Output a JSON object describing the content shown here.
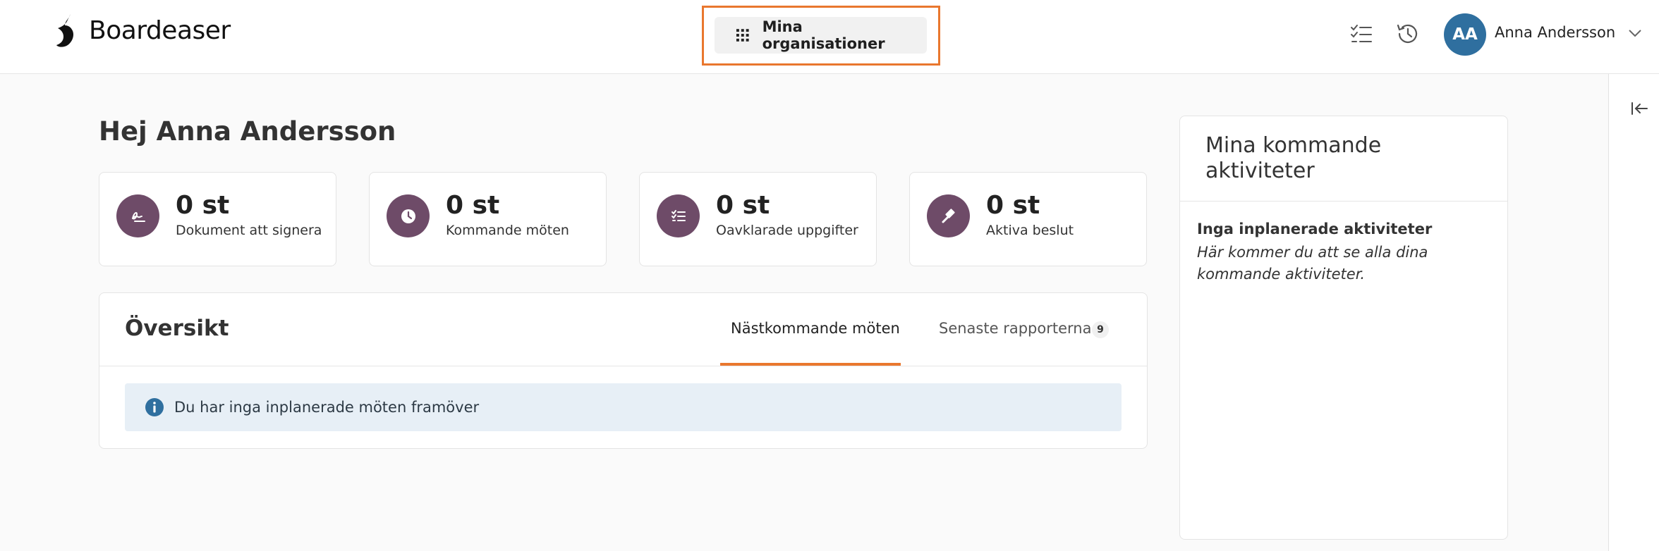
{
  "header": {
    "brand": "Boardeaser",
    "org_button_label": "Mina organisationer",
    "avatar_initials": "AA",
    "user_name": "Anna Andersson"
  },
  "main": {
    "greeting": "Hej Anna Andersson",
    "stats": [
      {
        "value": "0 st",
        "label": "Dokument att signera",
        "icon": "signature-icon"
      },
      {
        "value": "0 st",
        "label": "Kommande möten",
        "icon": "clock-icon"
      },
      {
        "value": "0 st",
        "label": "Oavklarade uppgifter",
        "icon": "checklist-icon"
      },
      {
        "value": "0 st",
        "label": "Aktiva beslut",
        "icon": "gavel-icon"
      }
    ],
    "overview": {
      "title": "Översikt",
      "tabs": [
        {
          "label": "Nästkommande möten",
          "active": true
        },
        {
          "label": "Senaste rapporterna",
          "badge": "9",
          "active": false
        }
      ],
      "info_message": "Du har inga inplanerade möten framöver"
    }
  },
  "activities": {
    "title": "Mina kommande aktiviteter",
    "empty_title": "Inga inplanerade aktiviteter",
    "empty_description": "Här kommer du att se alla dina kommande aktiviteter."
  },
  "colors": {
    "accent": "#e9772e",
    "stat_icon_bg": "#6e4b68",
    "avatar_bg": "#2f6f9f",
    "info_bg": "#e7eff6",
    "info_icon": "#2f6f9f"
  }
}
